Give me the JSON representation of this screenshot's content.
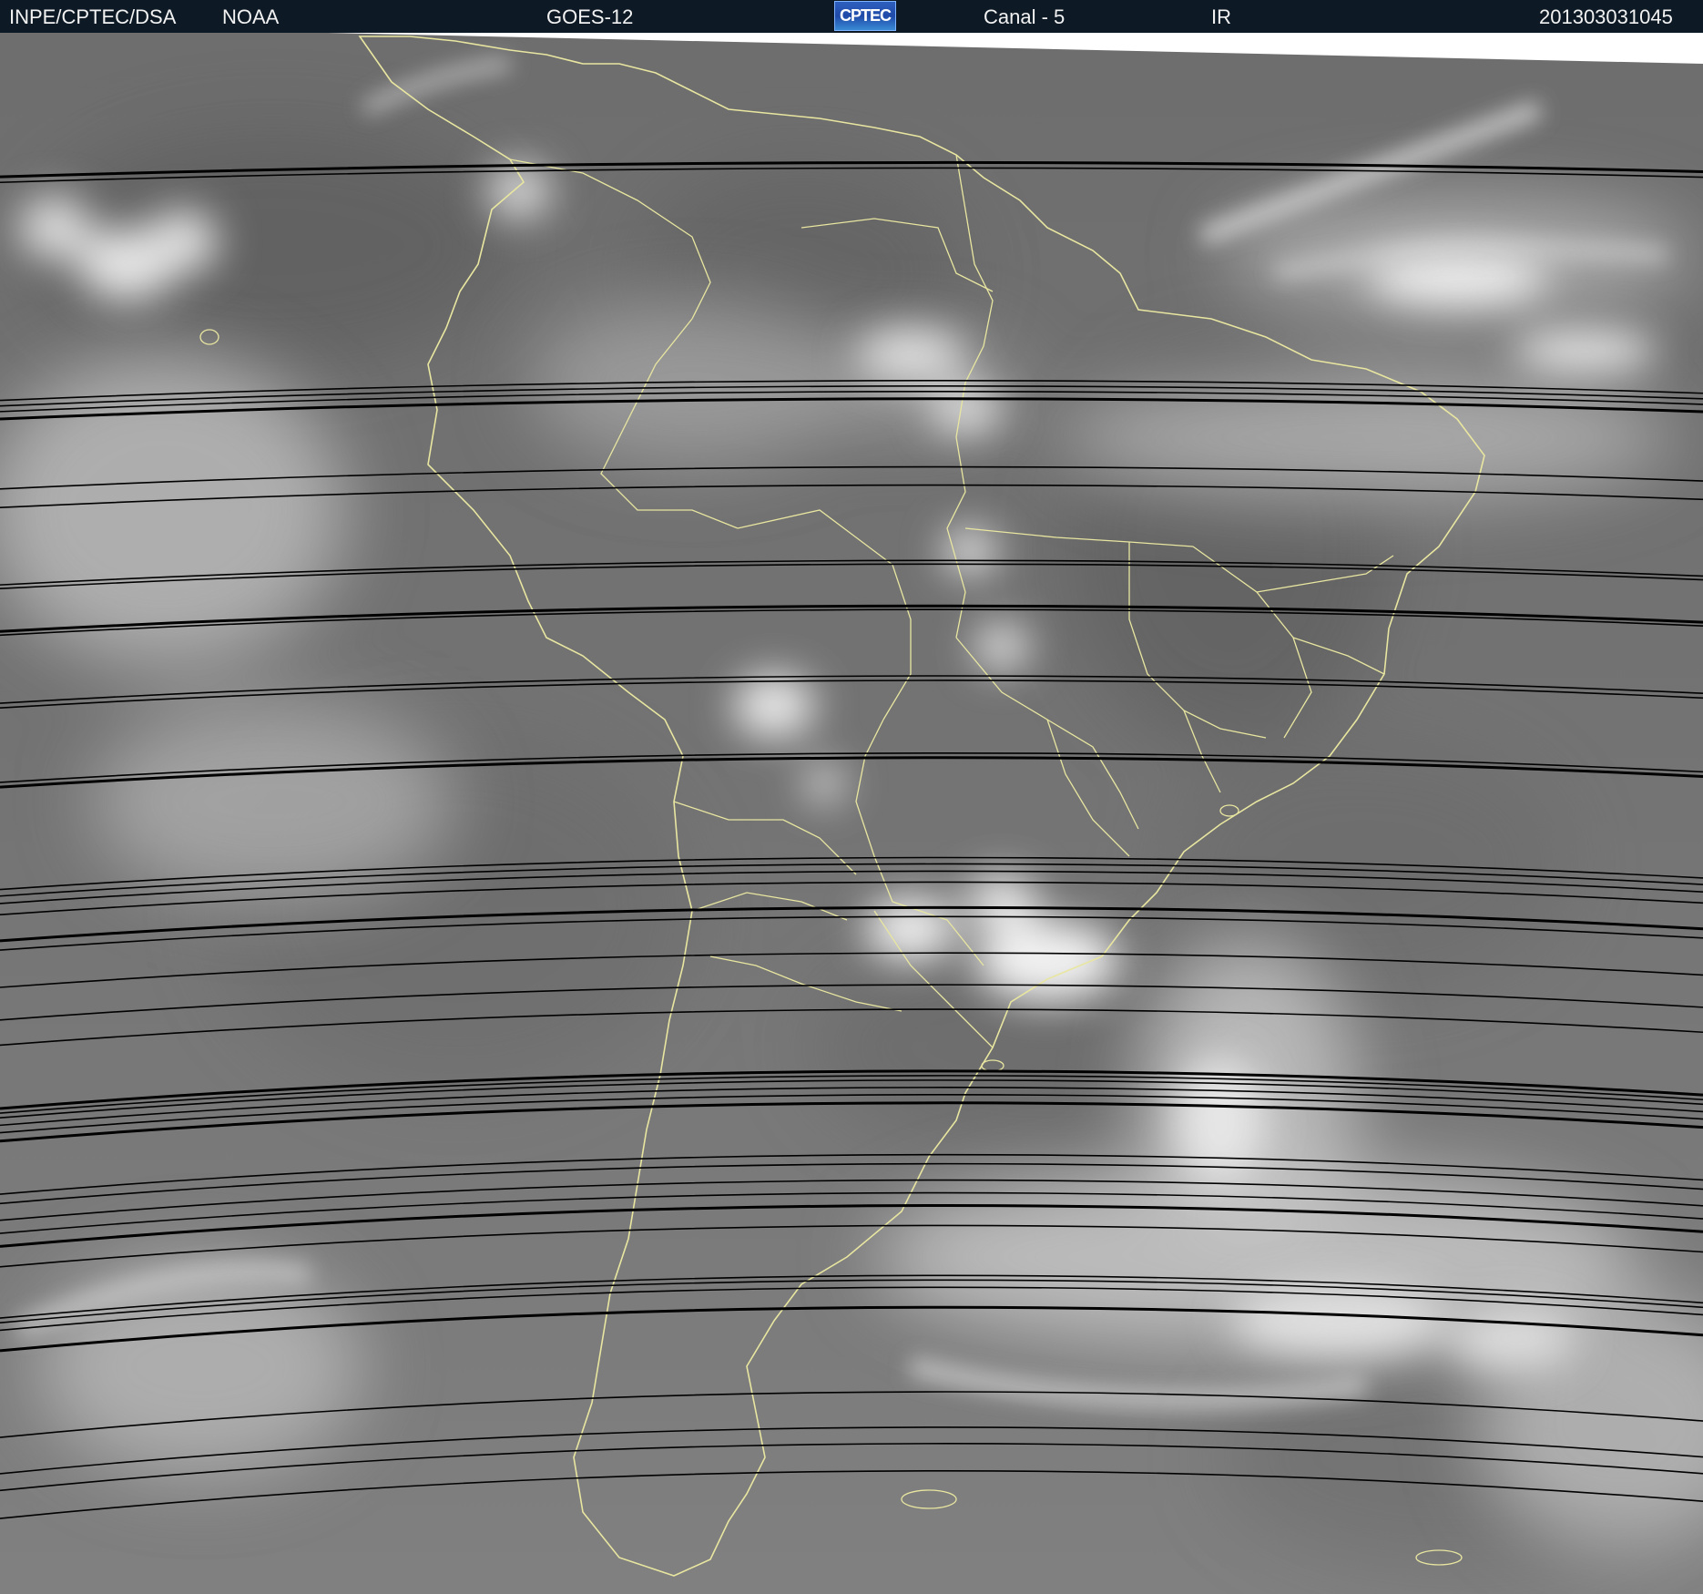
{
  "header": {
    "org": "INPE/CPTEC/DSA",
    "agency": "NOAA",
    "satellite": "GOES-12",
    "logo_text": "CPTEC",
    "channel": "Canal - 5",
    "band": "IR",
    "timestamp": "201303031045"
  },
  "colors": {
    "header_bg": "#0d1a26",
    "coastline": "#e8e6a0",
    "scanline": "#000000"
  }
}
